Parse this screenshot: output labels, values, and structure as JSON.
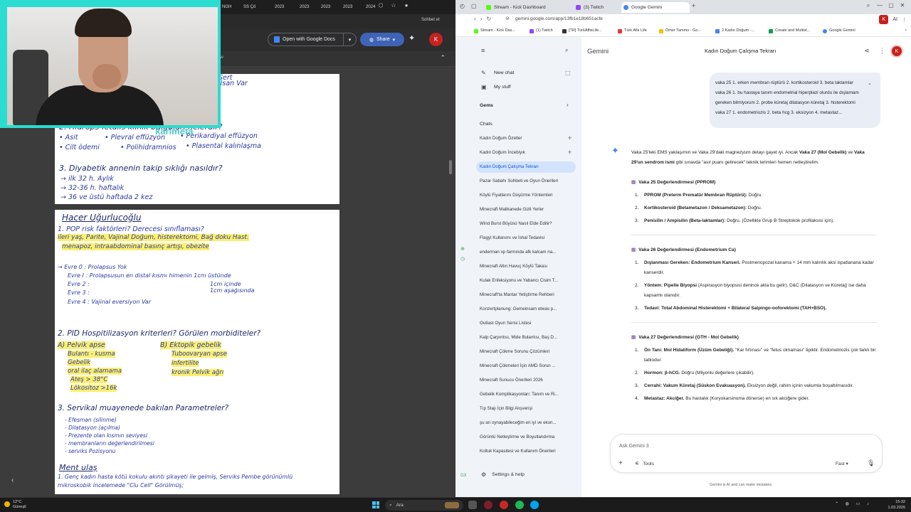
{
  "left": {
    "tabs": [
      "NGH",
      "SS Çö",
      "2023",
      "2023",
      "2023",
      "2023",
      "2024"
    ],
    "toolbar": {
      "open_with": "Open with Google Docs",
      "share": "Share",
      "avatar": "K",
      "chat_label": "Sohbet et"
    },
    "subbar": {
      "view_text": "ew"
    },
    "watermark": "karimeta",
    "page1": {
      "top_frag1": "Sert",
      "top_frag2": "ilsan Var",
      "q2_title": "2. Hidrops fetalis klinik bulguları nelerdir?",
      "q2_l1a": "• Asit",
      "q2_l1b": "• Plevral effüzyon",
      "q2_l1c": "• Perikardiyal effüzyon",
      "q2_l2a": "• Cilt ödemi",
      "q2_l2b": "• Polihidramnios",
      "q2_l2c": "• Plasental kalınlaşma",
      "q3_title": "3. Diyabetik annenin takip sıklığı nasıldır?",
      "q3_l1": "→ ilk 32 h.   Aylık",
      "q3_l2": "→ 32-36 h.   haftalık",
      "q3_l3": "→ 36 ve üstü   haftada 2 kez"
    },
    "page2": {
      "name": "Hacer Uğurlucoğlu",
      "q1": "1. POP risk faktörleri? Derecesi sınıflaması?",
      "q1_l1": "ileri yaş, Parite, Vajinal Doğum, histerektomi, Bağ doku Hast.",
      "q1_l2": "menapoz, intraabdominal basınç artışı, obezite",
      "e0": "→ Evre 0 : Prolapsus Yok",
      "e1": "Evre I : Prolapsusun en distal kısmı himenin 1cm üstünde",
      "e2": "Evre 2 :",
      "e2b": "1cm içinde",
      "e3": "Evre 3 :",
      "e3b": "1cm aşağısında",
      "e4": "Evre 4 : Vajinal eversiyon Var",
      "q2": "2. PID Hospitilizasyon kriterleri? Görülen morbiditeler?",
      "q2_a": "A) Pelvik apse",
      "q2_a2": "Bulantı - kusma",
      "q2_a3": "Gebelik",
      "q2_a4": "oral ilaç alamama",
      "q2_a5": "Ateş > 38°C",
      "q2_a6": "Lökositoz >16k",
      "q2_b": "B) Ektopik gebelik",
      "q2_b2": "Tuboovaryan apse",
      "q2_b3": "infertilite",
      "q2_b4": "kronik Pelvik ağrı",
      "q3": "3. Servikal muayenede bakılan Parametreler?",
      "q3_l1": "- Efesman (silinme)",
      "q3_l2": "- Dilatasyon (açılma)",
      "q3_l3": "- Prezente olan kısmın seviyesi",
      "q3_l4": "- membranların değerlendirilmesi",
      "q3_l5": "- serviks Pozisyonu",
      "ment": "Ment ulaş",
      "ment_l1": "1. Genç kadın hasta kötü kokulu akıntı şikayeti ile gelmiş, Serviks Pembe görünümlü",
      "ment_l2": "mikroskobik incelemede \"Clu Cell\" Görülmüş;"
    }
  },
  "right": {
    "tabs": [
      "Stream - Kick Dashboard",
      "(3) Twitch",
      "Google Gemini"
    ],
    "url": "gemini.google.com/app/13fb1e18b651acfe",
    "addr_right": "AI",
    "bookmarks": [
      "Stream - Kick Das...",
      "(1) Twitch",
      "[TR] TürkAffisLife...",
      "Türk Afis Life",
      "Ömer Tammo - Go...",
      "2.Kadın Doğum -...",
      "Create and Multist...",
      "Google Gemini"
    ],
    "sidebar": {
      "new_chat": "New chat",
      "my_stuff": "My stuff",
      "gems": "Gems",
      "chats": "Chats",
      "chat_items": [
        "Kadın Doğum Özetler",
        "Kadın Doğum İncebiyık",
        "Kadın Doğum Çalışma Tekrarı",
        "Pazar Sabahı Sohbeti ve Oyun Önerileri",
        "Köylü Fiyatlarını Düşürme Yöntemleri",
        "Minecraft Malikanede Gizli Yerler",
        "Wind Burst Büyüsü Nasıl Elde Edilir?",
        "Flagyl Kullanımı ve İshal Tedavisi",
        "enderman xp farmında afk kalcam na...",
        "Minecraft Altın Havuç Köylü Takası",
        "Kulak Enfeksiyonu ve Yabancı Cisim T...",
        "Minecraft'ta Mantar Yetiştirme Rehberi",
        "Konzertplanung: Gemeinsam etwas p...",
        "Outlast Oyun Serisi Listesi",
        "Kalp Çarpıntısı, Mide Bulantısı, Baş D...",
        "Minecraft Çökme Sorunu Çözümleri",
        "Minecraft Çökmeleri İçin AMD Sorun ...",
        "Minecraft Sunucu Önerileri 2026",
        "Gebelik Komplikasyonları: Tanım ve Ri...",
        "Tıp Stajı İçin Bilgi Alışverişi",
        "şu an oynayabileceğim en iyi ve ekon...",
        "Görüntü Netleştirme ve Boyutlandırma",
        "Koltuk Kapasitesi ve Kullanım Önerileri"
      ],
      "settings": "Settings & help"
    },
    "main": {
      "brand": "Gemini",
      "title": "Kadın Doğum Çalışma Tekrarı",
      "avatar": "K",
      "user_msg": "vaka 25 1. erken membran rüptürü 2. kortikosteroid 3. beta laktamlar vaka 26 1. bu hastaya tanım endometrial hiperplazi olurdu ile dışlamam gereken bilmiyorum 2. probe küretaj dilatasyon küretaj 3. histerektomi vaka 27 1. endometriozis 2. beta hcg 3. eksizyon 4. metastaz...",
      "intro_a": "Vaka 25'teki EMS yaklaşımın ve Vaka 29'daki magnezyum detayı gayet iyi. Ancak ",
      "intro_b1": "Vaka 27 (Mol Gebelik)",
      "intro_c": " ve ",
      "intro_b2": "Vaka 29'un sendrom ismi",
      "intro_d": " gibi sınavda \"asıl puanı getirecek\" teknik terimleri hemen netleştirelim.",
      "s25_title": "Vaka 25 Değerlendirmesi (PPROM)",
      "s25": [
        {
          "b": "PPROM (Preterm Prematür Membran Rüptürü):",
          "t": " Doğru."
        },
        {
          "b": "Kortikosteroid (Betametazon / Deksametazon):",
          "t": " Doğru."
        },
        {
          "b": "Penisilin / Ampisilin (Beta-laktamlar):",
          "t": " Doğru. (Özellikle Grup B Streptokok profilaksisi için)."
        }
      ],
      "s26_title": "Vaka 26 Değerlendirmesi (Endometrium Ca)",
      "s26": [
        {
          "b": "Dışlanması Gereken: Endometrium Kanseri.",
          "t": " Postmenopozal kanama + 14 mm kalınlık aksi ispatlanana kadar kanserdir."
        },
        {
          "b": "Yöntem: Pipelle Biyopsi",
          "t": " (Aspirasyon biyopsisi denince akla bu gelir). D&C (Dilatasyon ve Küretaj) ise daha kapsamlı olanıdır."
        },
        {
          "b": "Tedavi: Total Abdominal Histerektomi + Bilateral Salpingo-ooforektomi (TAH+BSO).",
          "t": ""
        }
      ],
      "s27_title": "Vaka 27 Değerlendirmesi (GTH - Mol Gebelik)",
      "s27": [
        {
          "b": "Ön Tanı: Mol Hidatiform (Üzüm Gebeliği).",
          "t": " \"Kar fırtınası\" ve \"fetus olmaması\" tipiktir. Endometriozis çok farklı bir tablodur."
        },
        {
          "b": "Hormon: β-hCG.",
          "t": " Doğru (Milyonlu değerlere çıkabilir)."
        },
        {
          "b": "Cerrahi: Vakum Küretaj (Süskon Evakuasyon).",
          "t": " Eksizyon değil, rahim içinin vakumla boşaltılmasıdır."
        },
        {
          "b": "Metastaz: Akciğer.",
          "t": " Bu hastalık (Koryokarsinoma dönerse) en sık akciğere gider."
        }
      ],
      "input_placeholder": "Ask Gemini 3",
      "tools": "Tools",
      "mode": "Fast",
      "disclaimer": "Gemini is AI and can make mistakes."
    }
  },
  "taskbar": {
    "weather_temp": "12°C",
    "weather_desc": "Güneşli",
    "search": "Ara",
    "time": "15:32",
    "date": "1.03.2026"
  },
  "colors": {
    "accent_blue": "#0b57d0",
    "share_blue": "#3f63b7",
    "avatar_red": "#c5221f",
    "highlight": "#fbf06e",
    "ink": "#1e2a6b"
  }
}
